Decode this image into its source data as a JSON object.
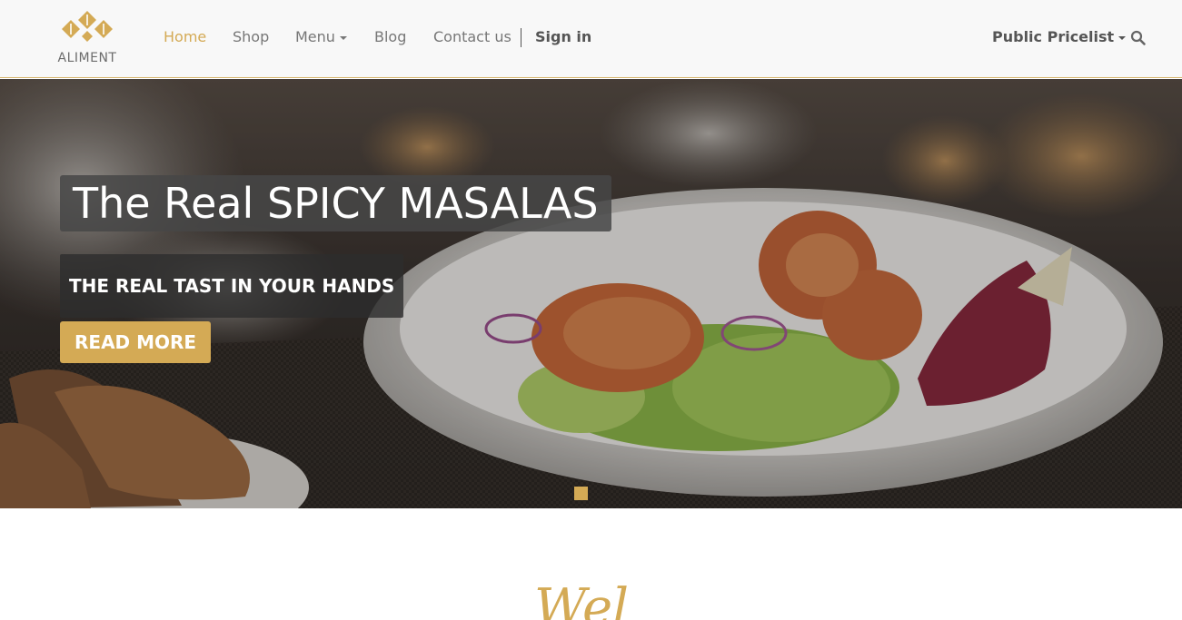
{
  "brand": {
    "name": "ALIMENT",
    "logo_color": "#d4aa55"
  },
  "nav": {
    "home": "Home",
    "shop": "Shop",
    "menu": "Menu",
    "blog": "Blog",
    "contact": "Contact us",
    "sign_in": "Sign in",
    "pricelist": "Public Pricelist",
    "search_icon": "search-icon"
  },
  "hero": {
    "title": "The Real SPICY MASALAS",
    "subtitle": "THE REAL TAST IN YOUR HANDS",
    "button_label": "READ MORE",
    "slide_count": 1,
    "active_slide": 1
  },
  "section": {
    "heading_partial": "Wel"
  },
  "colors": {
    "accent": "#d4aa55",
    "nav_text": "#777777",
    "header_bg": "#f8f8f8"
  }
}
